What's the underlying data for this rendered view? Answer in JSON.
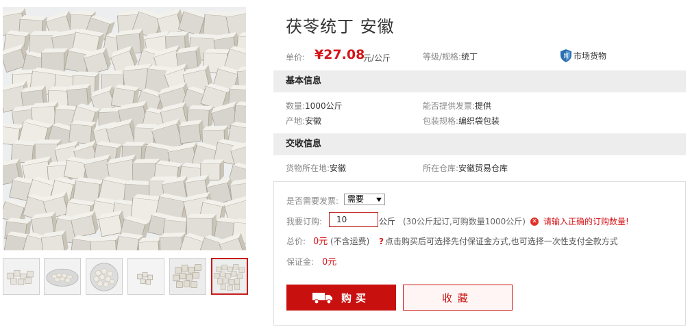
{
  "gallery": {
    "thumbnails": [
      {
        "icon": "cubes-pile"
      },
      {
        "icon": "slices-plate"
      },
      {
        "icon": "slices-plate"
      },
      {
        "icon": "cubes-scattered"
      },
      {
        "icon": "cubes-heap"
      },
      {
        "icon": "cubes-pile",
        "active": true
      }
    ]
  },
  "product": {
    "title": "茯苓统丁 安徽",
    "price_label": "单价:",
    "price": "¥27.08",
    "price_unit": "元/公斤",
    "spec_label": "等级/规格:",
    "spec_value": "统丁",
    "badge_text": "市场货物",
    "badge_icon": "shield-icon"
  },
  "basic_info": {
    "heading": "基本信息",
    "quantity_label": "数量:",
    "quantity_value": "1000公斤",
    "invoice_label": "能否提供发票:",
    "invoice_value": "提供",
    "origin_label": "产地:",
    "origin_value": "安徽",
    "packaging_label": "包装规格:",
    "packaging_value": "编织袋包装"
  },
  "delivery_info": {
    "heading": "交收信息",
    "location_label": "货物所在地:",
    "location_value": "安徽",
    "warehouse_label": "所在仓库:",
    "warehouse_value": "安徽贸易仓库"
  },
  "order": {
    "invoice_q_label": "是否需要发票:",
    "invoice_selected": "需要",
    "qty_label": "我要订购:",
    "qty_value": "10",
    "qty_unit": "公斤",
    "qty_hint": "(30公斤起订,可购数量1000公斤)",
    "error_text": "请输入正确的订购数量!",
    "total_label": "总价:",
    "total_value": "0元",
    "total_note": "(不含运费)",
    "help_text": "点击购买后可选择先付保证金方式,也可选择一次性支付全款方式",
    "deposit_label": "保证金:",
    "deposit_value": "0元",
    "buy_label": "购买",
    "fav_label": "收藏"
  },
  "colors": {
    "accent": "#c8110f",
    "price": "#d4151a",
    "section_bg": "#ededed"
  }
}
